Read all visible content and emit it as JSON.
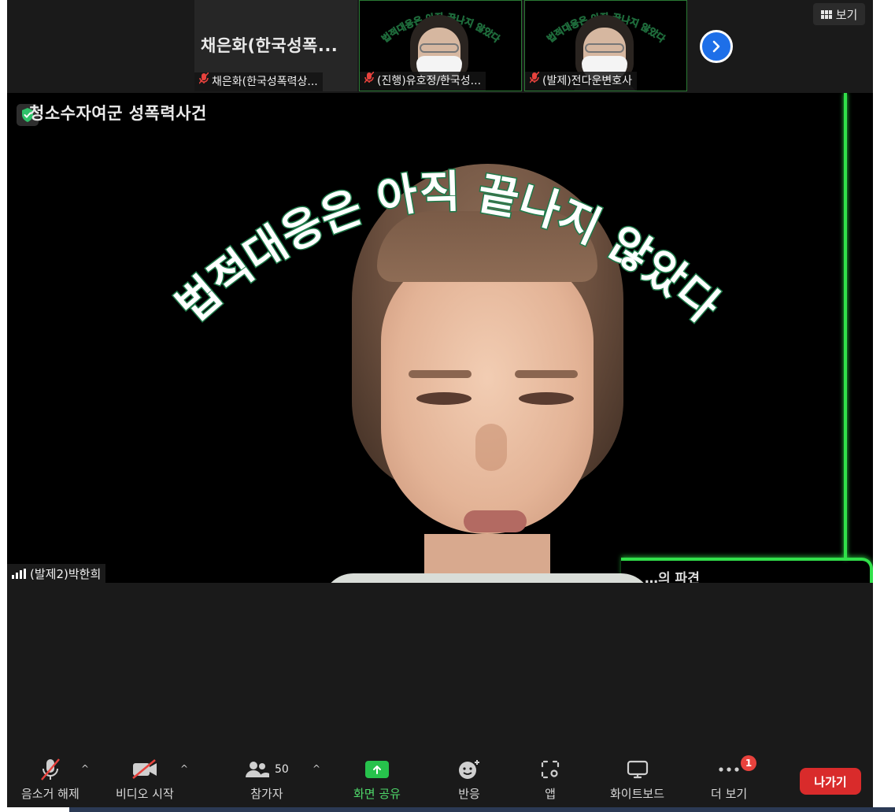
{
  "strip": {
    "thumbs": [
      {
        "big_name": "채은화(한국성폭...",
        "label": "채은화(한국성폭력상..."
      },
      {
        "label": "(진행)유호정/한국성...",
        "mini_title": "법적대응은 아직 끝나지 않았다"
      },
      {
        "label": "(발제)전다운변호사",
        "mini_title": "법적대응은 아직 끝나지 않았다"
      }
    ],
    "view_label": "보기"
  },
  "video": {
    "caption": "청소수자여군 성폭력사건",
    "arc_title": "법적대응은 아직 끝나지 않았다",
    "corner_text": "…의 파견",
    "speaker_name": "(발제2)박한희"
  },
  "toolbar": {
    "mute_label": "음소거 해제",
    "video_label": "비디오 시작",
    "participants_label": "참가자",
    "participants_count": "50",
    "share_label": "화면 공유",
    "reactions_label": "반응",
    "apps_label": "앱",
    "whiteboard_label": "화이트보드",
    "more_label": "더 보기",
    "more_badge": "1",
    "leave_label": "나가기"
  },
  "colors": {
    "accent_green": "#31e04a",
    "leave_red": "#d92b2b",
    "muted_red": "#e8423d",
    "next_blue": "#1e6fe8"
  }
}
